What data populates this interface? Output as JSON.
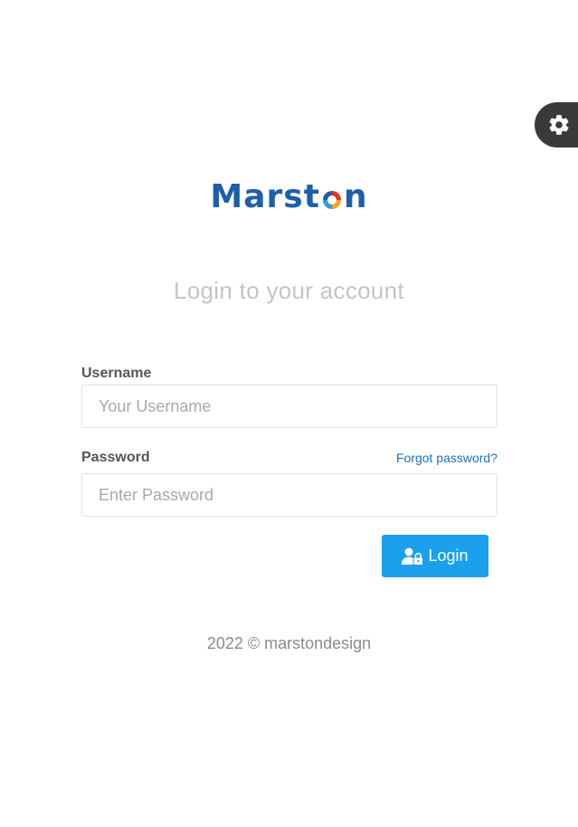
{
  "settings": {
    "icon": "gear-icon",
    "background": "#3a3a3a"
  },
  "logo": {
    "text_before": "Marst",
    "text_after": "n",
    "color": "#1f5ea8"
  },
  "title": "Login to your account",
  "form": {
    "username": {
      "label": "Username",
      "placeholder": "Your Username",
      "value": ""
    },
    "password": {
      "label": "Password",
      "placeholder": "Enter Password",
      "value": ""
    },
    "forgot_link": "Forgot password?",
    "login_button": {
      "label": "Login",
      "icon": "user-lock-icon",
      "color": "#1aa0ec"
    }
  },
  "footer": "2022 © marstondesign"
}
